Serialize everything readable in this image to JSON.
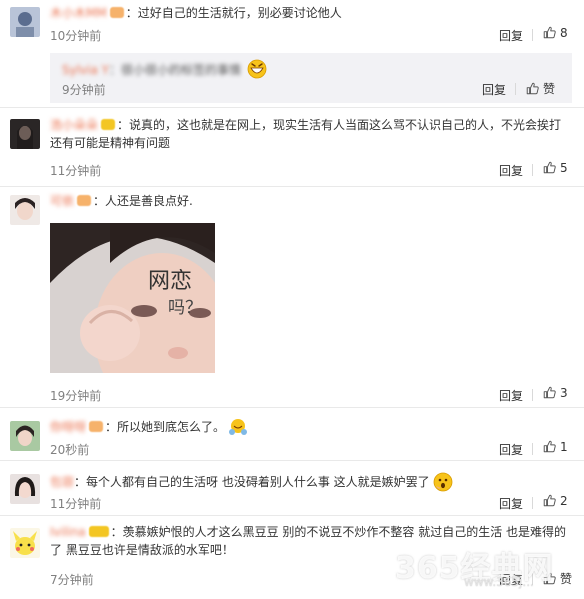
{
  "comments": [
    {
      "username": "木小木MM",
      "text": "：过好自己的生活就行，别必要讨论他人",
      "time": "10分钟前",
      "reply": "回复",
      "likes": "8",
      "subreply": {
        "username": "Sylvia Y",
        "text": "：很小很小的标签的事情",
        "time": "9分钟前",
        "reply": "回复",
        "likes": "赞"
      }
    },
    {
      "username": "浩小朵朵",
      "text": "：说真的，这也就是在网上，现实生活有人当面这么骂不认识自己的人，不光会挨打还有可能是精神有问题",
      "time": "11分钟前",
      "reply": "回复",
      "likes": "5"
    },
    {
      "username": "可依",
      "text": "：人还是善良点好.",
      "time": "19分钟前",
      "reply": "回复",
      "likes": "3",
      "photo": {
        "main_text": "网恋",
        "sub_text": "吗？"
      }
    },
    {
      "username": "你呀呀",
      "text": "：所以她到底怎么了。",
      "time": "20秒前",
      "reply": "回复",
      "likes": "1"
    },
    {
      "username": "包容",
      "text": "：每个人都有自己的生活呀 也没碍着别人什么事 这人就是嫉妒罢了",
      "time": "11分钟前",
      "reply": "回复",
      "likes": "2"
    },
    {
      "username": "Ivilina",
      "text": "：羡慕嫉妒恨的人才这么黑豆豆 别的不说豆不炒作不整容 就过自己的生活 也是难得的了 黑豆豆也许是情敌派的水军吧！",
      "time": "7分钟前",
      "reply": "回复",
      "likes": "赞"
    }
  ],
  "watermark": {
    "brand": "365经典网",
    "url": "www.365j..."
  },
  "colors": {
    "username": "#eb7350",
    "time": "#808080",
    "text": "#333333",
    "divider": "#e9e9e9"
  }
}
